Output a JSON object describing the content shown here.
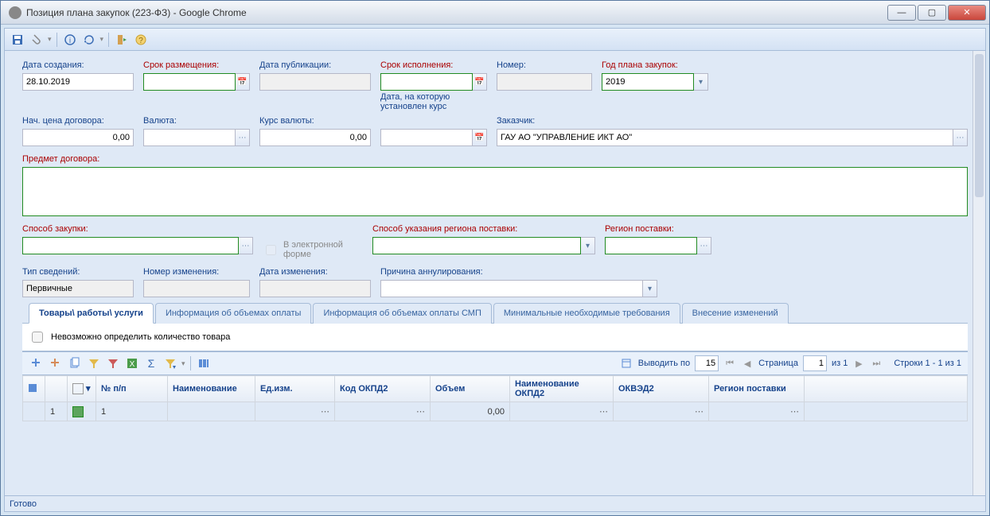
{
  "window": {
    "title": "Позиция плана закупок (223-ФЗ) - Google Chrome"
  },
  "fields": {
    "creation_date_label": "Дата создания:",
    "creation_date": "28.10.2019",
    "placement_label": "Срок размещения:",
    "placement": "",
    "pub_date_label": "Дата публикации:",
    "pub_date": "",
    "execution_label": "Срок исполнения:",
    "execution": "",
    "number_label": "Номер:",
    "number": "",
    "year_label": "Год плана закупок:",
    "year": "2019",
    "contract_price_label": "Нач. цена договора:",
    "contract_price": "0,00",
    "currency_label": "Валюта:",
    "currency": "",
    "rate_label": "Курс валюты:",
    "rate": "0,00",
    "rate_date_label_top": "Дата, на которую",
    "rate_date_label_bottom": "установлен курс",
    "rate_date": "",
    "customer_label": "Заказчик:",
    "customer": "ГАУ АО \"УПРАВЛЕНИЕ ИКТ АО\"",
    "subject_label": "Предмет договора:",
    "subject": "",
    "purchase_method_label": "Способ закупки:",
    "purchase_method": "",
    "electronic_label": "В электронной форме",
    "region_way_label": "Способ указания региона поставки:",
    "region_way": "",
    "region_label": "Регион поставки:",
    "region": "",
    "info_type_label": "Тип сведений:",
    "info_type": "Первичные",
    "change_no_label": "Номер изменения:",
    "change_no": "",
    "change_date_label": "Дата изменения:",
    "change_date": "",
    "cancel_reason_label": "Причина аннулирования:",
    "cancel_reason": ""
  },
  "tabs": {
    "goods": "Товары\\ работы\\ услуги",
    "payments": "Информация об объемах оплаты",
    "smp": "Информация об объемах оплаты СМП",
    "req": "Минимальные необходимые требования",
    "changes": "Внесение изменений"
  },
  "panel": {
    "cannot_determine": "Невозможно определить количество товара"
  },
  "pager": {
    "output_by": "Выводить по",
    "per_page": "15",
    "page_label": "Страница",
    "page": "1",
    "of": "из 1",
    "rows": "Строки 1 - 1 из 1"
  },
  "grid": {
    "headers": {
      "npp": "№ п/п",
      "name": "Наименование",
      "unit": "Ед.изм.",
      "okpd2": "Код ОКПД2",
      "volume": "Объем",
      "okpd2_name": "Наименование ОКПД2",
      "okved2": "ОКВЭД2",
      "region": "Регион поставки"
    },
    "rows": [
      {
        "idx": "1",
        "npp": "1",
        "name": "",
        "unit": "",
        "okpd2": "",
        "volume": "0,00",
        "okpd2_name": "",
        "okved2": "",
        "region": ""
      }
    ]
  },
  "status": "Готово"
}
